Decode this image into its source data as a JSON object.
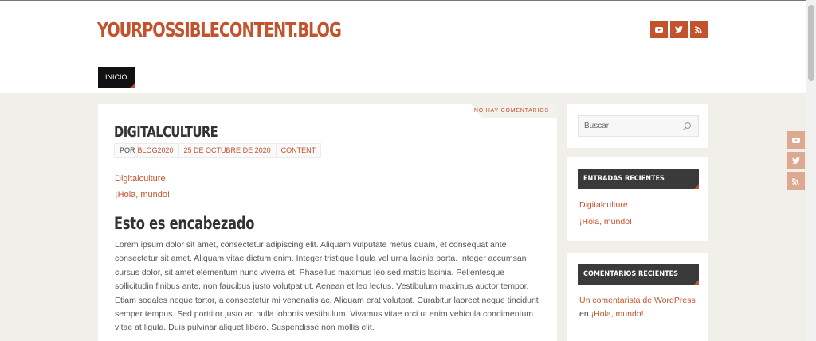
{
  "site": {
    "title": "YOURPOSSIBLECONTENT.BLOG"
  },
  "social_icons": [
    "youtube-icon",
    "twitter-icon",
    "rss-icon"
  ],
  "nav": {
    "items": [
      {
        "label": "INICIO"
      }
    ]
  },
  "post": {
    "comments_label": "NO HAY COMENTARIOS",
    "title": "DIGITALCULTURE",
    "meta": {
      "by_label": "POR",
      "author": "BLOG2020",
      "date": "25 DE OCTUBRE DE 2020",
      "category": "CONTENT"
    },
    "links": [
      "Digitalculture",
      "¡Hola, mundo!"
    ],
    "heading": "Esto es encabezado",
    "body": "Lorem ipsum dolor sit amet, consectetur adipiscing elit. Aliquam vulputate metus quam, et consequat ante consectetur sit amet. Aliquam vitae dictum enim. Integer tristique ligula vel urna lacinia porta. Integer accumsan cursus dolor, sit amet elementum nunc viverra et. Phasellus maximus leo sed mattis lacinia. Pellentesque sollicitudin finibus ante, non faucibus justo volutpat ut. Aenean et leo lectus. Vestibulum maximus auctor tempor. Etiam sodales neque tortor, a consectetur mi venenatis ac. Aliquam erat volutpat. Curabitur laoreet neque tincidunt semper tempus. Sed porttitor justo ac nulla lobortis vestibulum. Vivamus vitae orci ut enim vehicula condimentum vitae at ligula. Duis pulvinar aliquet libero. Suspendisse non mollis elit."
  },
  "sidebar": {
    "search": {
      "placeholder": "Buscar"
    },
    "recent_posts": {
      "title": "ENTRADAS RECIENTES",
      "items": [
        "Digitalculture",
        "¡Hola, mundo!"
      ]
    },
    "recent_comments": {
      "title": "COMENTARIOS RECIENTES",
      "author": "Un comentarista de WordPress",
      "connector": "en",
      "post": "¡Hola, mundo!"
    }
  },
  "colors": {
    "accent": "#c2532d",
    "background": "#f0efe9",
    "dark": "#3a3a3a"
  }
}
